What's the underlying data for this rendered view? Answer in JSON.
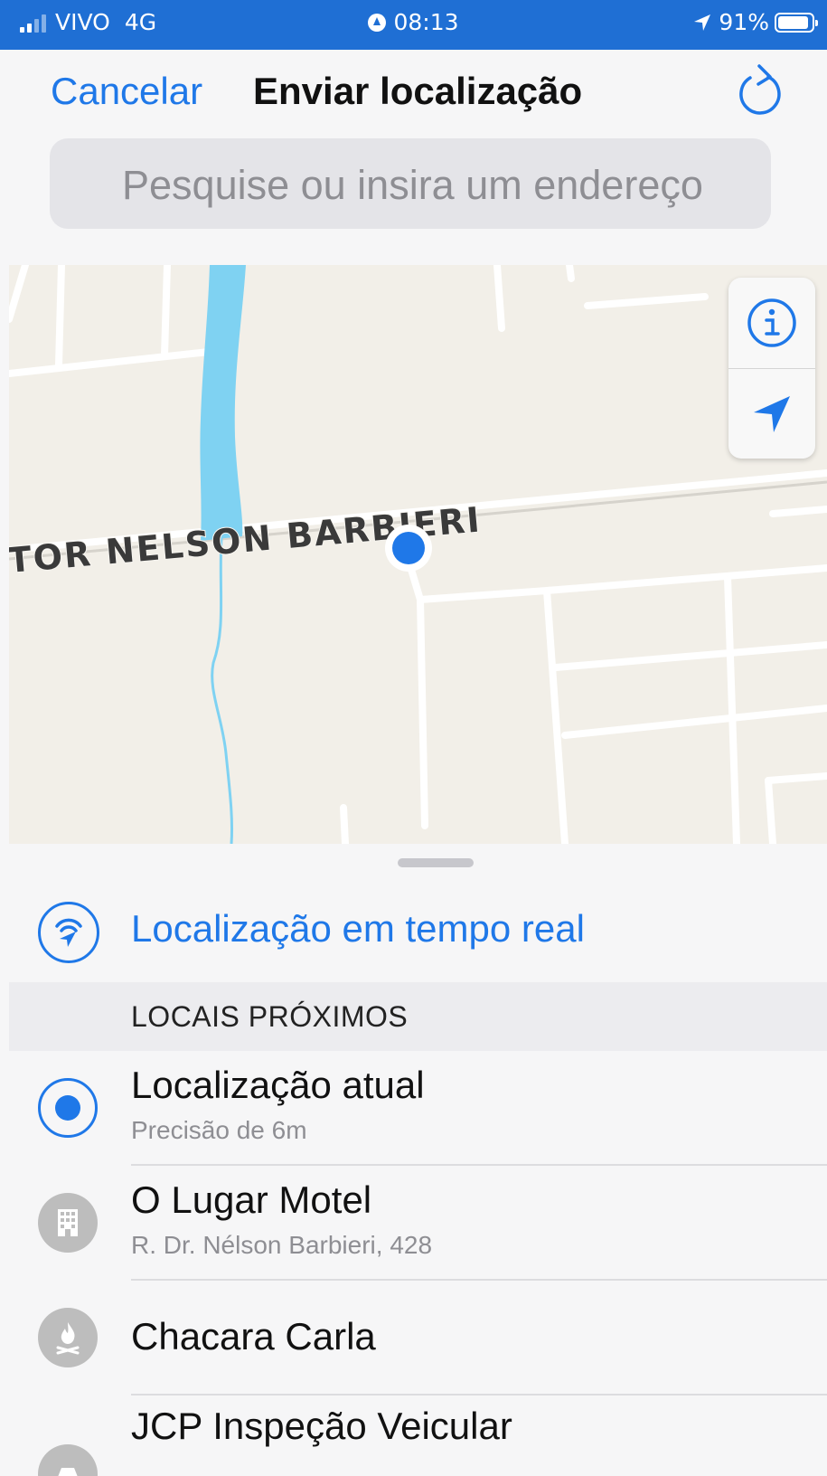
{
  "status_bar": {
    "carrier": "VIVO",
    "network": "4G",
    "time": "08:13",
    "battery_percent": "91%",
    "battery_level": 0.91
  },
  "header": {
    "cancel_label": "Cancelar",
    "title": "Enviar localização",
    "refresh_icon": "refresh-icon"
  },
  "search": {
    "placeholder": "Pesquise ou insira um endereço"
  },
  "map": {
    "street_label": "TOR NELSON BARBIERI",
    "controls": [
      "info-icon",
      "location-arrow-icon"
    ],
    "colors": {
      "land": "#f2efe8",
      "water": "#7fd2f2",
      "road": "#ffffff",
      "pin": "#1f78e8"
    }
  },
  "sheet": {
    "live_location_label": "Localização em tempo real",
    "section_title": "LOCAIS PRÓXIMOS",
    "places": [
      {
        "name": "Localização atual",
        "subtitle": "Precisão de 6m",
        "icon": "current-location-icon"
      },
      {
        "name": "O Lugar Motel",
        "subtitle": "R. Dr. Nélson Barbieri, 428",
        "icon": "building-icon"
      },
      {
        "name": "Chacara Carla",
        "subtitle": "",
        "icon": "campfire-icon"
      },
      {
        "name": "JCP Inspeção Veicular",
        "subtitle": "",
        "icon": "car-icon"
      }
    ]
  },
  "accent_color": "#1f78e8"
}
